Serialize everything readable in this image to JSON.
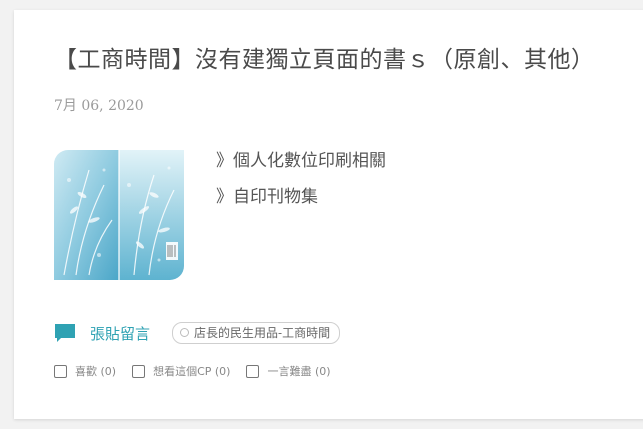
{
  "post": {
    "title": "【工商時間】沒有建獨立頁面的書ｓ（原創、其他）",
    "date": "7月 06, 2020",
    "cover_alt": "book cover illustration",
    "links": [
      {
        "label": "》個人化數位印刷相關"
      },
      {
        "label": "》自印刊物集"
      }
    ]
  },
  "footer": {
    "comment_label": "張貼留言",
    "tag_label": "店長的民生用品-工商時間",
    "reactions": [
      {
        "label": "喜歡 (0)"
      },
      {
        "label": "想看這個CP (0)"
      },
      {
        "label": "一言難盡 (0)"
      }
    ]
  },
  "colors": {
    "accent": "#2fa2b3",
    "title": "#4a4a4a",
    "date": "#9a9a9a",
    "background": "#f2f2f2",
    "card": "#ffffff"
  },
  "icons": {
    "comment": "speech-bubble-icon",
    "tag": "circle-dot-icon",
    "checkbox": "checkbox-icon"
  }
}
